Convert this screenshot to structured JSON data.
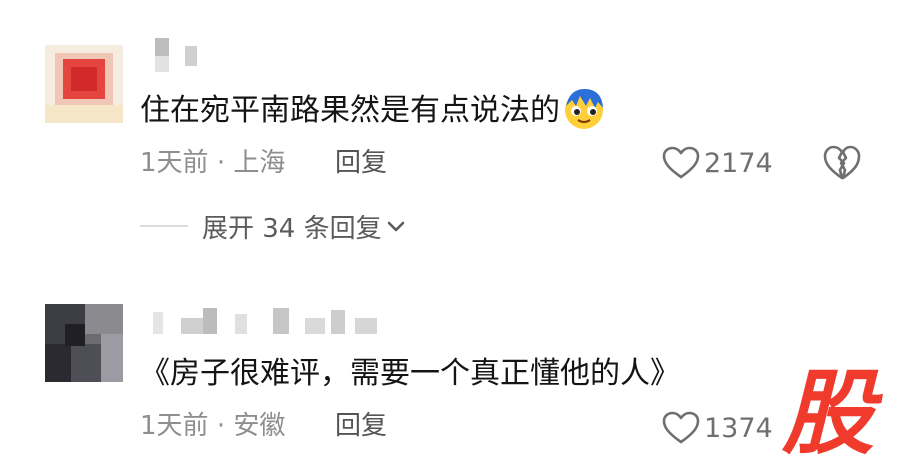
{
  "comments": [
    {
      "text": "住在宛平南路果然是有点说法的",
      "emoji": "smile-emoji",
      "time": "1天前",
      "separator": "·",
      "location": "上海",
      "reply_label": "回复",
      "likes": "2174",
      "expand_label": "展开 34 条回复"
    },
    {
      "text": "《房子很难评，需要一个真正懂他的人》",
      "time": "1天前",
      "separator": "·",
      "location": "安徽",
      "reply_label": "回复",
      "likes": "1374"
    }
  ],
  "watermark": "股",
  "colors": {
    "text": "#141414",
    "meta": "#8e8e8e",
    "watermark": "#f03a2c"
  }
}
